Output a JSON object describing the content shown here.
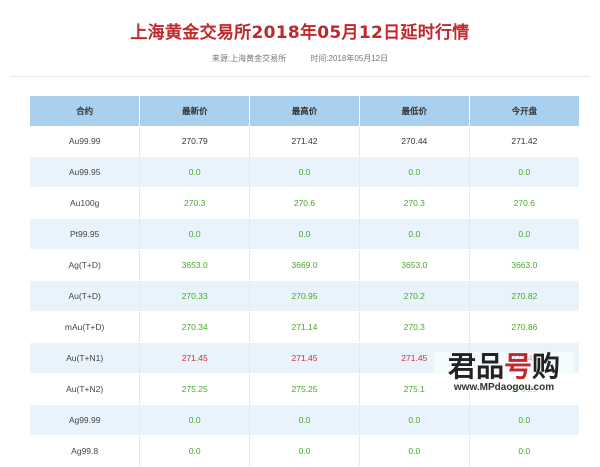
{
  "title": "上海黄金交易所2018年05月12日延时行情",
  "meta": {
    "source": "来源:上海黄金交易所",
    "time": "时间:2018年05月12日"
  },
  "table": {
    "headers": [
      "合约",
      "最新价",
      "最高价",
      "最低价",
      "今开盘"
    ],
    "rows": [
      {
        "name": "Au99.99",
        "trend": "neutral",
        "values": [
          "270.79",
          "271.42",
          "270.44",
          "271.42"
        ]
      },
      {
        "name": "Au99.95",
        "trend": "up",
        "values": [
          "0.0",
          "0.0",
          "0.0",
          "0.0"
        ]
      },
      {
        "name": "Au100g",
        "trend": "up",
        "values": [
          "270.3",
          "270.6",
          "270.3",
          "270.6"
        ]
      },
      {
        "name": "Pt99.95",
        "trend": "up",
        "values": [
          "0.0",
          "0.0",
          "0.0",
          "0.0"
        ]
      },
      {
        "name": "Ag(T+D)",
        "trend": "up",
        "values": [
          "3653.0",
          "3669.0",
          "3653.0",
          "3663.0"
        ]
      },
      {
        "name": "Au(T+D)",
        "trend": "up",
        "values": [
          "270.33",
          "270.95",
          "270.2",
          "270.82"
        ]
      },
      {
        "name": "mAu(T+D)",
        "trend": "up",
        "values": [
          "270.34",
          "271.14",
          "270.3",
          "270.86"
        ]
      },
      {
        "name": "Au(T+N1)",
        "trend": "down",
        "values": [
          "271.45",
          "271.45",
          "271.45",
          "271.45"
        ]
      },
      {
        "name": "Au(T+N2)",
        "trend": "up",
        "values": [
          "275.25",
          "275.25",
          "275.1",
          "275.25"
        ]
      },
      {
        "name": "Ag99.99",
        "trend": "up",
        "values": [
          "0.0",
          "0.0",
          "0.0",
          "0.0"
        ]
      },
      {
        "name": "Ag99.8",
        "trend": "up",
        "values": [
          "0.0",
          "0.0",
          "0.0",
          "0.0"
        ]
      }
    ]
  },
  "watermark": {
    "logo_main": "君品",
    "logo_accent": "号",
    "logo_end": "购",
    "url": "www.MPdaogou.com"
  },
  "colors": {
    "title": "#c0282c",
    "header_bg": "#a9d0ef",
    "row_alt": "#e9f3fb",
    "up": "#4aa72a",
    "down": "#d32f2f"
  }
}
